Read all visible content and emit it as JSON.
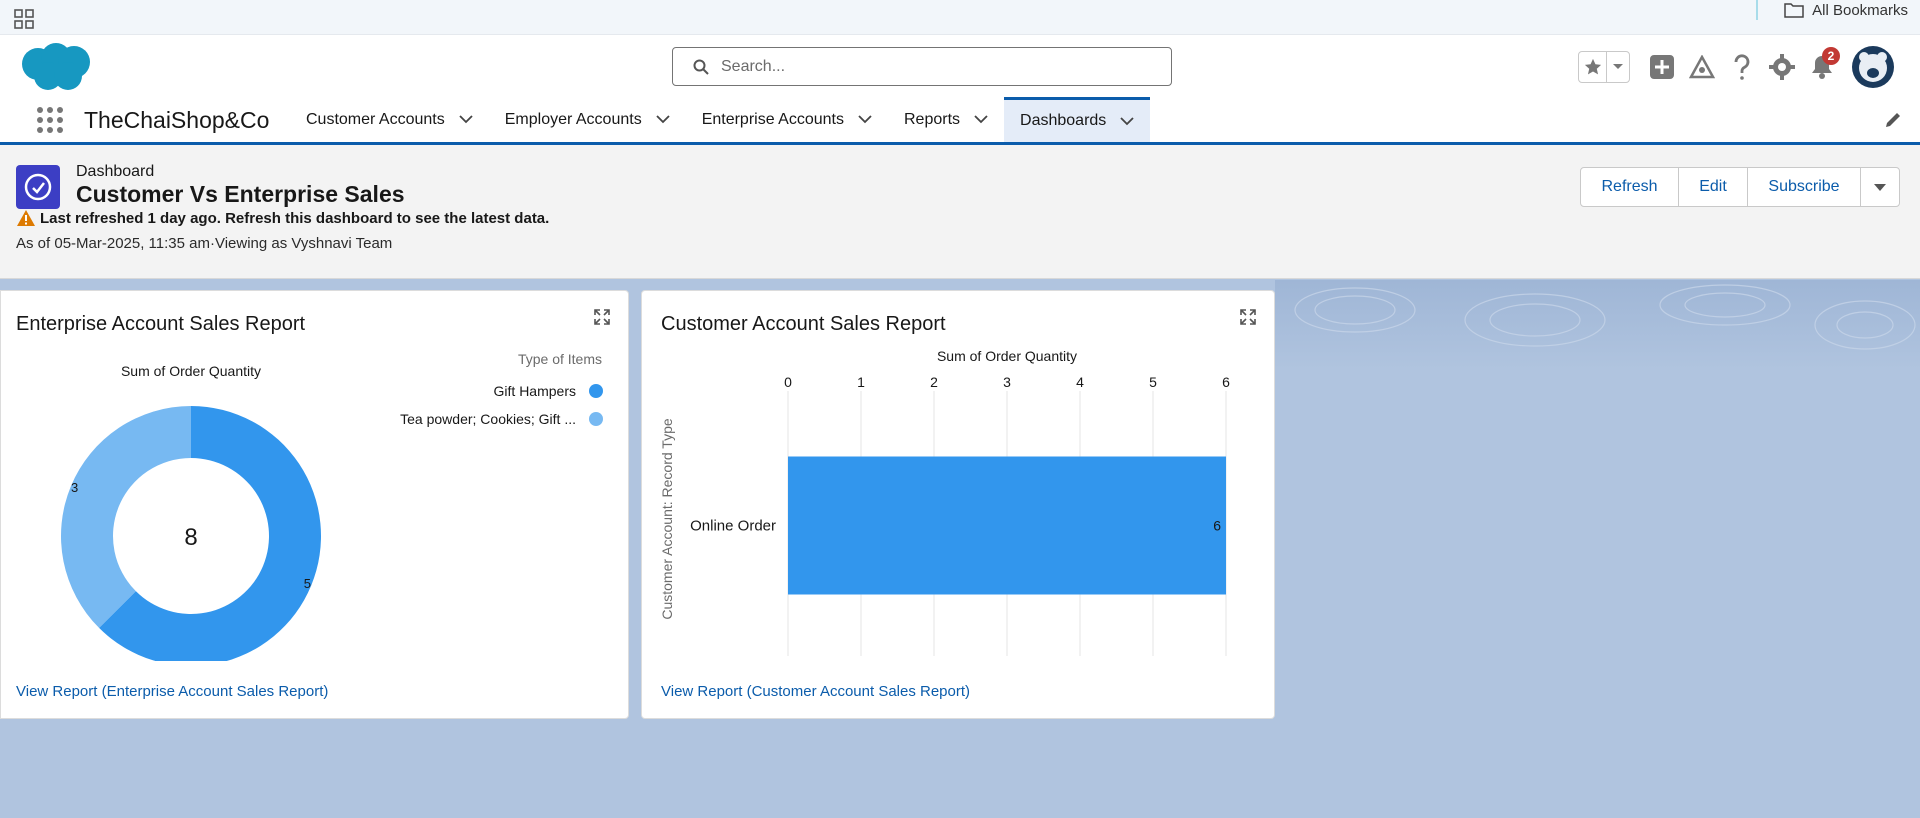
{
  "browser": {
    "bookmarks_label": "All Bookmarks"
  },
  "header": {
    "search_placeholder": "Search...",
    "notification_count": "2"
  },
  "app": {
    "name": "TheChaiShop&Co",
    "tabs": [
      {
        "label": "Customer Accounts",
        "active": false
      },
      {
        "label": "Employer Accounts",
        "active": false
      },
      {
        "label": "Enterprise Accounts",
        "active": false
      },
      {
        "label": "Reports",
        "active": false
      },
      {
        "label": "Dashboards",
        "active": true
      }
    ]
  },
  "dashboard": {
    "type_label": "Dashboard",
    "title": "Customer Vs Enterprise Sales",
    "warning": "Last refreshed 1 day ago. Refresh this dashboard to see the latest data.",
    "as_of": "As of 05-Mar-2025, 11:35 am·Viewing as Vyshnavi Team",
    "buttons": {
      "refresh": "Refresh",
      "edit": "Edit",
      "subscribe": "Subscribe"
    }
  },
  "cards": {
    "enterprise": {
      "title": "Enterprise Account Sales Report",
      "link": "View Report (Enterprise Account Sales Report)"
    },
    "customer": {
      "title": "Customer Account Sales Report",
      "link": "View Report (Customer Account Sales Report)"
    }
  },
  "colors": {
    "brand_blue": "#0b5cab",
    "series_dark": "#3296ed",
    "series_light": "#77b9f2",
    "dashboard_icon": "#3c3ec4",
    "warning": "#dd7a01",
    "badge": "#c23934"
  },
  "chart_data": [
    {
      "type": "pie",
      "variant": "donut",
      "title": "Sum of Order Quantity",
      "legend_title": "Type of Items",
      "legend_position": "top-right",
      "total": 8,
      "slices": [
        {
          "label": "Gift Hampers",
          "value": 5,
          "color": "#3296ed"
        },
        {
          "label": "Tea powder; Cookies; Gift ...",
          "value": 3,
          "color": "#77b9f2"
        }
      ]
    },
    {
      "type": "bar",
      "orientation": "horizontal",
      "title": "Sum of Order Quantity",
      "ylabel": "Customer Account: Record Type",
      "categories": [
        "Online Order"
      ],
      "values": [
        6
      ],
      "xlim": [
        0,
        6
      ],
      "xticks": [
        0,
        1,
        2,
        3,
        4,
        5,
        6
      ],
      "grid": true,
      "color": "#3296ed"
    }
  ]
}
